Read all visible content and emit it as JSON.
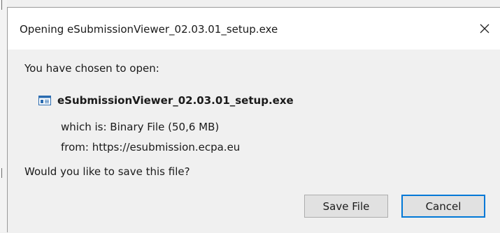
{
  "dialog": {
    "title": "Opening eSubmissionViewer_02.03.01_setup.exe",
    "intro": "You have chosen to open:",
    "file_name": "eSubmissionViewer_02.03.01_setup.exe",
    "which_is_label": "which is:",
    "which_is_value": "Binary File (50,6 MB)",
    "from_label": "from:",
    "from_value": "https://esubmission.ecpa.eu",
    "question": "Would you like to save this file?",
    "save_label": "Save File",
    "cancel_label": "Cancel",
    "icons": {
      "close": "close-icon",
      "file": "file-icon"
    },
    "colors": {
      "accent": "#0078d7",
      "titlebar": "#ffffff",
      "body": "#f0f0f0"
    }
  }
}
